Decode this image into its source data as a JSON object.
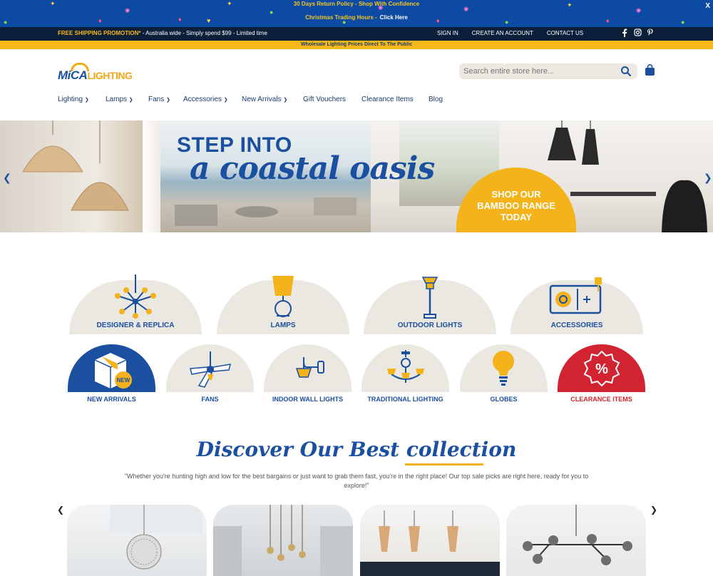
{
  "promo": {
    "line1": "30 Days Return Policy - Shop With Confidence",
    "line2": "Christmas Trading Hours -",
    "click_here": "Click Here",
    "close": "X"
  },
  "top_nav": {
    "shipping_bold": "FREE SHIPPING PROMOTION*",
    "shipping_rest": "- Australia wide - Simply spend $99 - Limited time",
    "sign_in": "SIGN IN",
    "create_account": "CREATE AN ACCOUNT",
    "contact_us": "CONTACT US",
    "social": [
      "facebook-icon",
      "instagram-icon",
      "pinterest-icon"
    ]
  },
  "wholesale": "Wholesale Lighting Prices Direct To The Public",
  "logo": {
    "mica": "MiCA",
    "lighting": "LIGHTING"
  },
  "search": {
    "placeholder": "Search entire store here..."
  },
  "nav": {
    "items": [
      {
        "label": "Lighting",
        "dropdown": true
      },
      {
        "label": "Lamps",
        "dropdown": true
      },
      {
        "label": "Fans",
        "dropdown": true
      },
      {
        "label": "Accessories",
        "dropdown": true
      },
      {
        "label": "New Arrivals",
        "dropdown": true
      },
      {
        "label": "Gift Vouchers",
        "dropdown": false
      },
      {
        "label": "Clearance Items",
        "dropdown": false
      },
      {
        "label": "Blog",
        "dropdown": false
      }
    ]
  },
  "hero": {
    "headline": "STEP INTO",
    "subheadline": "a coastal oasis",
    "cta": "SHOP OUR\nBAMBOO RANGE\nTODAY"
  },
  "categories": {
    "row1": [
      "DESIGNER & REPLICA",
      "LAMPS",
      "OUTDOOR LIGHTS",
      "ACCESSORIES"
    ],
    "row2": [
      "NEW ARRIVALS",
      "FANS",
      "INDOOR WALL LIGHTS",
      "TRADITIONAL LIGHTING",
      "GLOBES",
      "CLEARANCE ITEMS"
    ],
    "new_badge": "NEW",
    "clearance_symbol": "%"
  },
  "collection": {
    "title": "Discover Our Best collection",
    "quote": "\"Whether you're hunting high and low for the best bargains or just want to grab them fast, you're in the right place! Our top sale picks are right here, ready for you to explore!\""
  },
  "colors": {
    "brand_blue": "#1b4fa0",
    "brand_yellow": "#f4b21b",
    "promo_blue": "#0c4aa3",
    "top_nav_bg": "#0b1f3a",
    "clearance_red": "#d22430"
  }
}
